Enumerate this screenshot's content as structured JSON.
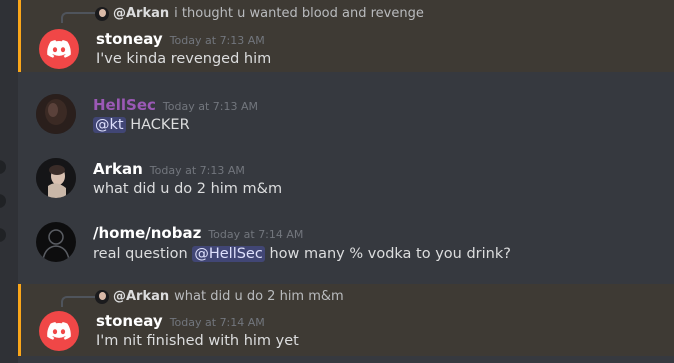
{
  "messages": [
    {
      "reply": {
        "name": "@Arkan",
        "text": "i thought u wanted blood and revenge"
      },
      "author": "stoneay",
      "timestamp": "Today at 7:13 AM",
      "content": "I've kinda revenged him"
    },
    {
      "author": "HellSec",
      "timestamp": "Today at 7:13 AM",
      "mention": "@kt",
      "content": "HACKER"
    },
    {
      "author": "Arkan",
      "timestamp": "Today at 7:13 AM",
      "content": "what did u do 2 him m&m"
    },
    {
      "author": "/home/nobaz",
      "timestamp": "Today at 7:14 AM",
      "content_before": "real question",
      "mention": "@HellSec",
      "content_after": "how many % vodka to you drink?"
    },
    {
      "reply": {
        "name": "@Arkan",
        "text": "what did u do 2 him m&m"
      },
      "author": "stoneay",
      "timestamp": "Today at 7:14 AM",
      "content": "I'm nit finished with him yet"
    }
  ],
  "colors": {
    "mention_bar": "#faa61a",
    "discord_red": "#f04747",
    "hellsec_name": "#9b59b6",
    "mention_pill": "#414675"
  }
}
